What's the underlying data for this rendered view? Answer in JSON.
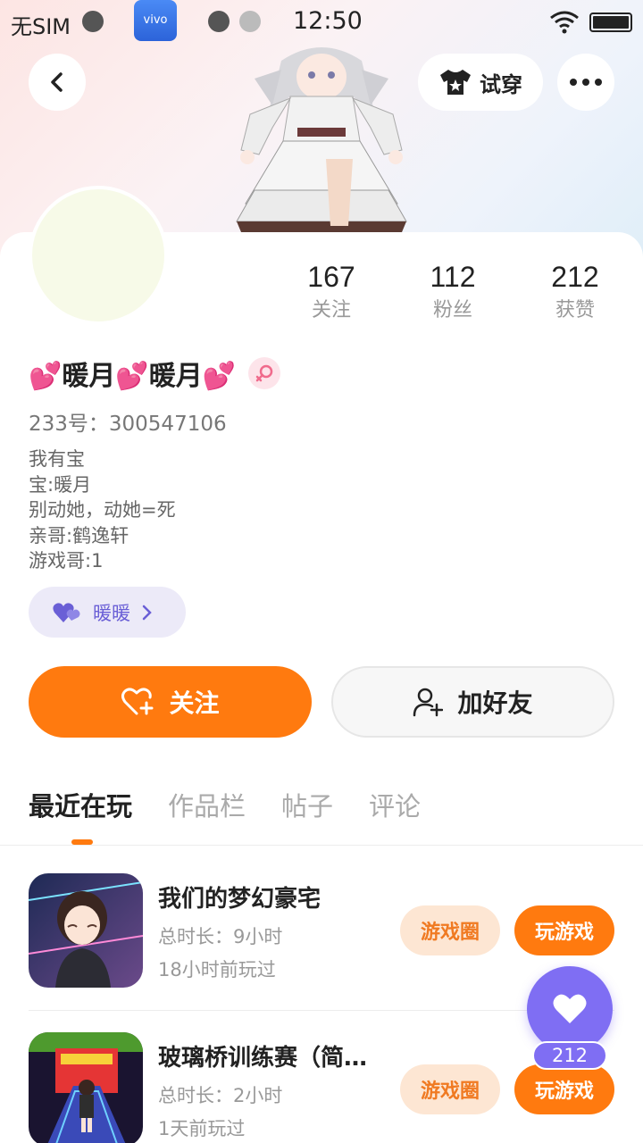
{
  "status_bar": {
    "carrier": "无SIM",
    "vivo_label": "vivo",
    "time": "12:50"
  },
  "header": {
    "try_on_label": "试穿",
    "back_icon": "chevron-left-icon",
    "more_icon": "more-dots-icon"
  },
  "stats": [
    {
      "value": "167",
      "label": "关注"
    },
    {
      "value": "112",
      "label": "粉丝"
    },
    {
      "value": "212",
      "label": "获赞"
    }
  ],
  "profile": {
    "nickname": "💕暖月💕暖月💕",
    "uid": "233号：300547106",
    "bio_lines": [
      "我有宝",
      "宝:暖月",
      "别动她，动她=死",
      "亲哥:鹤逸轩",
      "游戏哥:1"
    ],
    "couple_tag": "暖暖"
  },
  "actions": {
    "follow_label": "关注",
    "add_friend_label": "加好友"
  },
  "tabs": [
    "最近在玩",
    "作品栏",
    "帖子",
    "评论"
  ],
  "games": [
    {
      "title": "我们的梦幻豪宅",
      "duration": "总时长：9小时",
      "last_played": "18小时前玩过",
      "circle_label": "游戏圈",
      "play_label": "玩游戏"
    },
    {
      "title": "玻璃桥训练赛（简…",
      "duration": "总时长：2小时",
      "last_played": "1天前玩过",
      "circle_label": "游戏圈",
      "play_label": "玩游戏"
    }
  ],
  "float_like": {
    "count": "212"
  },
  "colors": {
    "accent": "#ff7a0f",
    "purple": "#7f6ef3",
    "gender_pink": "#f06b8c"
  }
}
